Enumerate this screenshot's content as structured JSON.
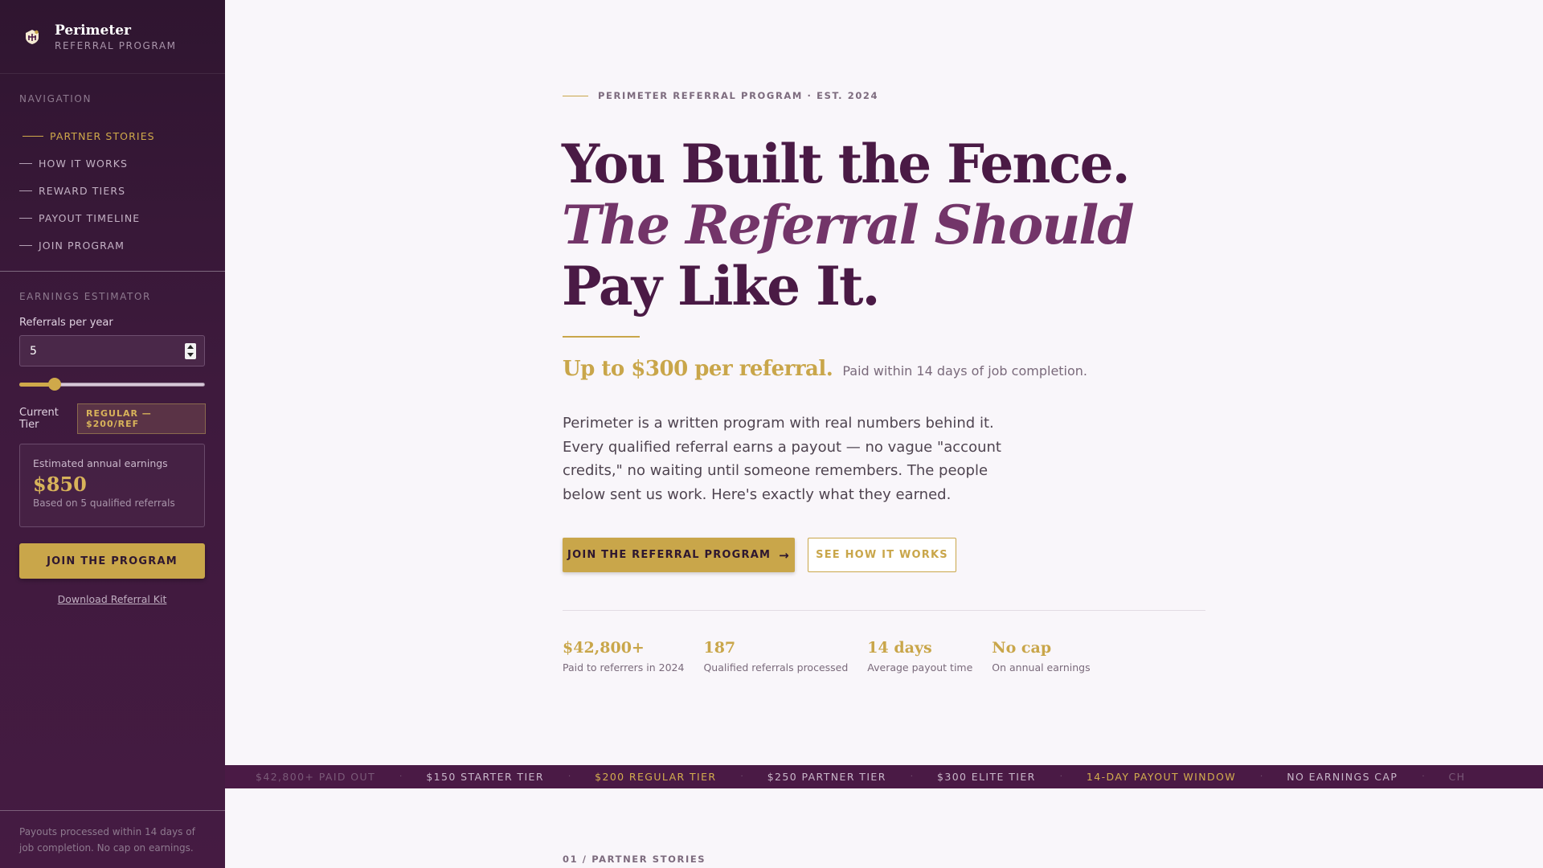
{
  "brand": {
    "name": "Perimeter",
    "subtitle": "REFERRAL PROGRAM"
  },
  "nav": {
    "label": "NAVIGATION",
    "items": [
      {
        "label": "PARTNER STORIES",
        "active": true
      },
      {
        "label": "HOW IT WORKS"
      },
      {
        "label": "REWARD TIERS"
      },
      {
        "label": "PAYOUT TIMELINE"
      },
      {
        "label": "JOIN PROGRAM"
      }
    ]
  },
  "estimator": {
    "label": "EARNINGS ESTIMATOR",
    "referrals_label": "Referrals per year",
    "referrals_value": "5",
    "slider_fraction": 0.19,
    "tier_label": "Current Tier",
    "tier_badge": "REGULAR — $200/REF",
    "earnings_label": "Estimated annual earnings",
    "earnings_value": "$850",
    "earnings_note": "Based on 5 qualified referrals",
    "join_button": "JOIN THE PROGRAM",
    "kit_link": "Download Referral Kit"
  },
  "sidebar_footer": "Payouts processed within 14 days of job completion. No cap on earnings.",
  "hero": {
    "eyebrow": "PERIMETER REFERRAL PROGRAM · EST. 2024",
    "line1": "You Built the Fence.",
    "line2": "The Referral Should",
    "line3": "Pay Like It.",
    "offer_big": "Up to $300 per referral.",
    "offer_small": "Paid within 14 days of job completion.",
    "body": "Perimeter is a written program with real numbers behind it. Every qualified referral earns a payout — no vague \"account credits,\" no waiting until someone remembers. The people below sent us work. Here's exactly what they earned.",
    "cta_primary": "JOIN THE REFERRAL PROGRAM",
    "cta_secondary": "SEE HOW IT WORKS"
  },
  "stats": [
    {
      "value": "$42,800+",
      "label": "Paid to referrers in 2024"
    },
    {
      "value": "187",
      "label": "Qualified referrals processed"
    },
    {
      "value": "14 days",
      "label": "Average payout time"
    },
    {
      "value": "No cap",
      "label": "On annual earnings"
    }
  ],
  "ticker": [
    "$42,800+ PAID OUT",
    "$150 STARTER TIER",
    "$200 REGULAR TIER",
    "$250 PARTNER TIER",
    "$300 ELITE TIER",
    "14-DAY PAYOUT WINDOW",
    "NO EARNINGS CAP",
    "CH"
  ],
  "section_tag": "01 / PARTNER STORIES",
  "colors": {
    "accent": "#c9a64a",
    "plum": "#4a1a45",
    "sidebar": "#3e1a3d"
  }
}
